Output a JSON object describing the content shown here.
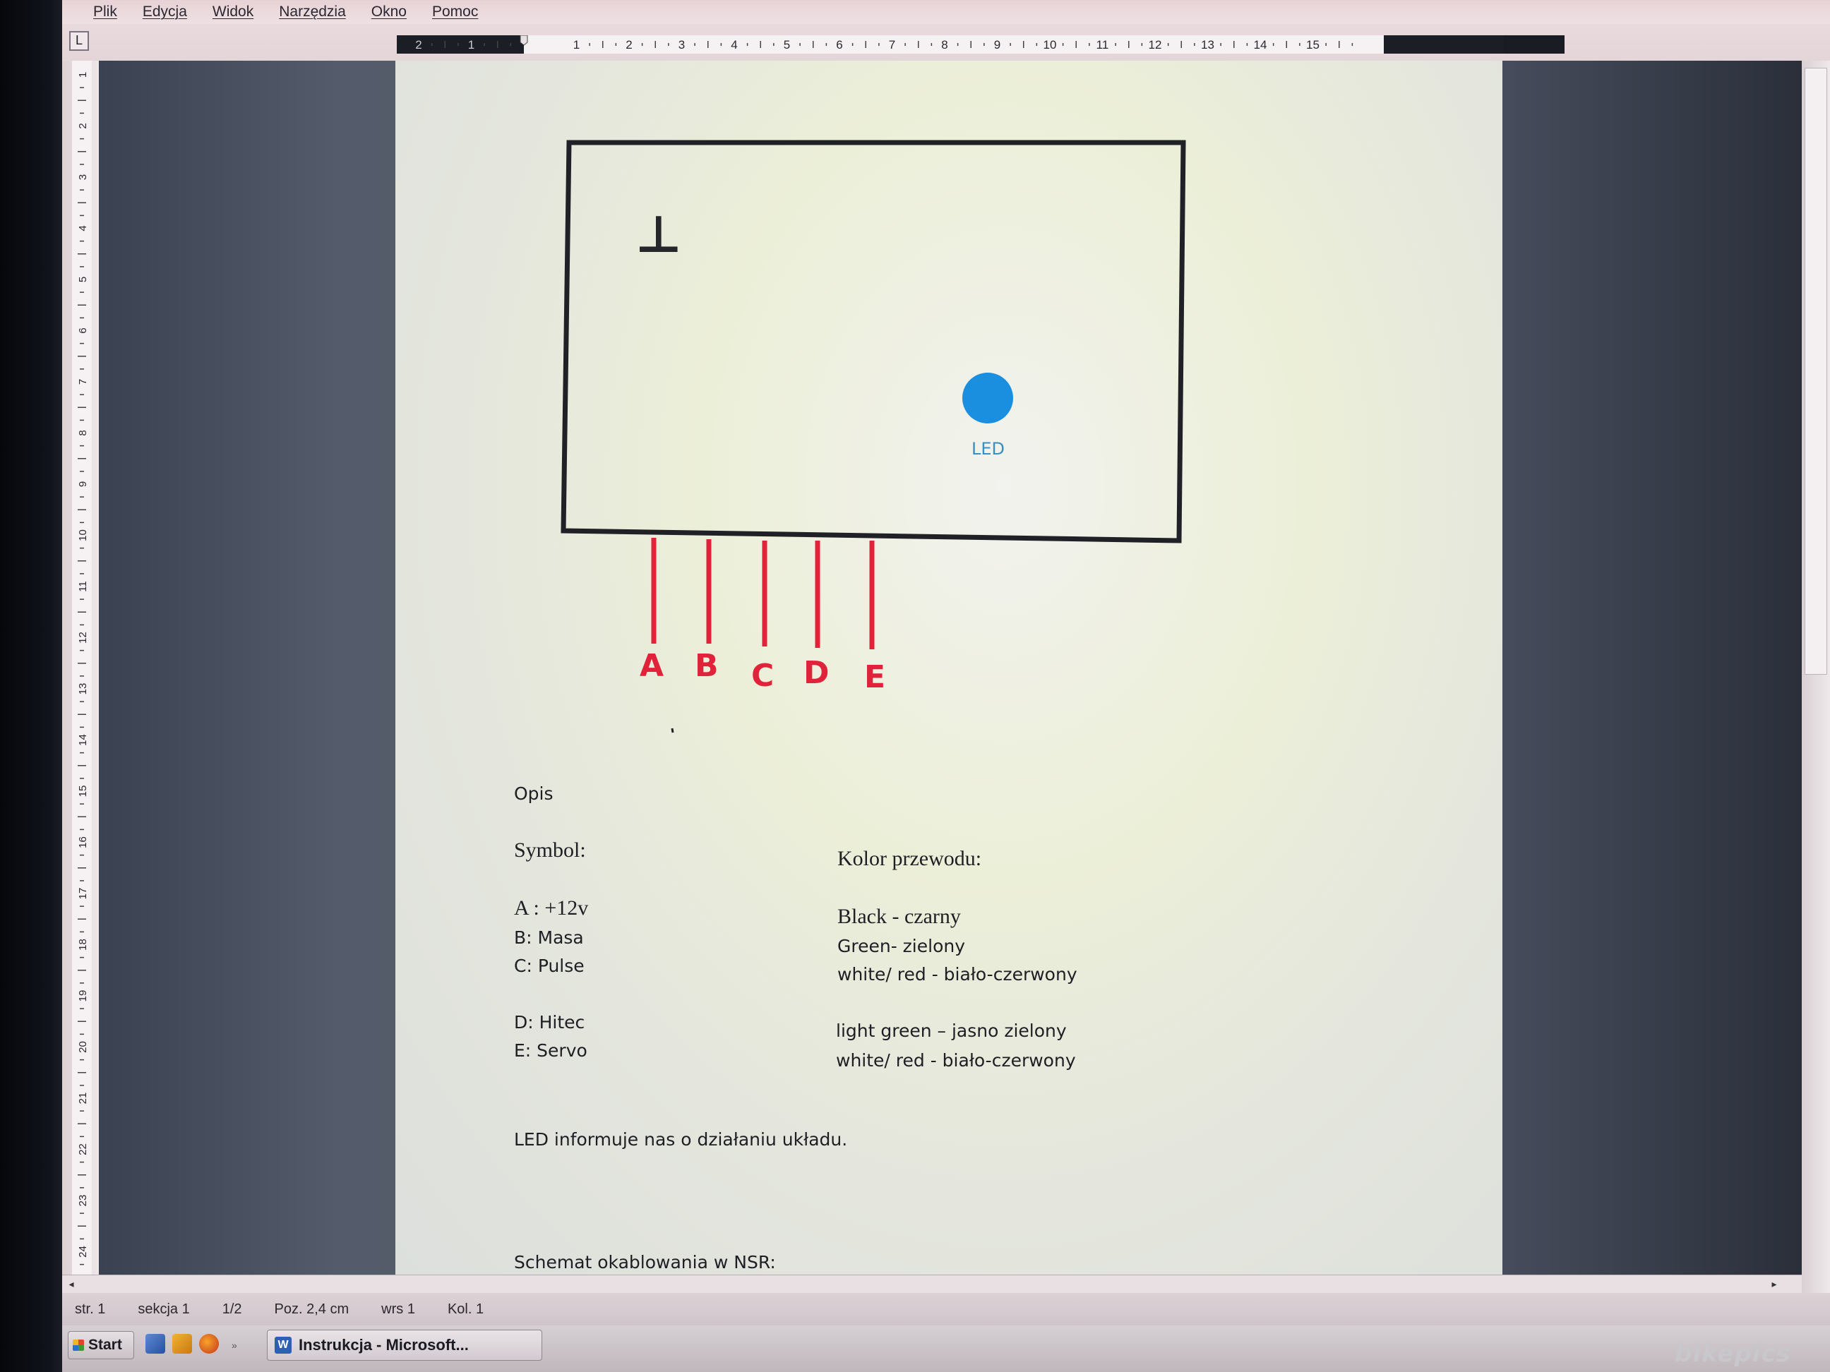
{
  "menu": [
    "Plik",
    "Edycja",
    "Widok",
    "Narzędzia",
    "Okno",
    "Pomoc"
  ],
  "ruler": {
    "tab_selector": "L",
    "h_numbers": [
      "2",
      "1",
      "1",
      "2",
      "3",
      "4",
      "5",
      "6",
      "7",
      "8",
      "9",
      "10",
      "11",
      "12",
      "13",
      "14",
      "15"
    ],
    "v_numbers": [
      "1",
      "2",
      "3",
      "4",
      "5",
      "6",
      "7",
      "8",
      "9",
      "10",
      "11",
      "12",
      "13",
      "14",
      "15",
      "16",
      "17",
      "18",
      "19",
      "20",
      "21",
      "22",
      "23",
      "24"
    ]
  },
  "diagram": {
    "ground_symbol": "⊥",
    "led_label": "LED",
    "pins": [
      "A",
      "B",
      "C",
      "D",
      "E"
    ],
    "pin_color": "#e0223a",
    "led_color": "#1a8fe0",
    "box_color": "#1f2126"
  },
  "document": {
    "heading": "Opis",
    "symbol_header": "Symbol:",
    "symbols": [
      "A : +12v",
      "B: Masa",
      "C: Pulse",
      "D: Hitec",
      "E: Servo"
    ],
    "color_header": "Kolor przewodu:",
    "colors": [
      "Black - czarny",
      "Green- zielony",
      "white/ red -  biało-czerwony",
      "light green – jasno zielony",
      " white/ red -  biało-czerwony"
    ],
    "led_note": "LED informuje nas o działaniu układu.",
    "schema_title": "Schemat okablowania w NSR:"
  },
  "status": {
    "page": "str. 1",
    "section": "sekcja 1",
    "pages": "1/2",
    "position": "Poz. 2,4 cm",
    "line": "wrs 1",
    "column": "Kol. 1"
  },
  "taskbar": {
    "start": "Start",
    "task": "Instrukcja - Microsoft..."
  },
  "watermark": "bikepics"
}
